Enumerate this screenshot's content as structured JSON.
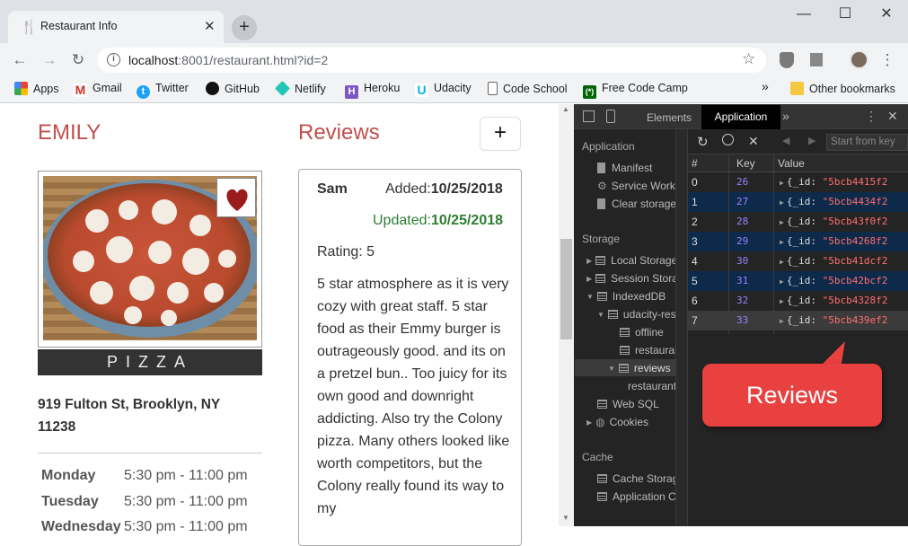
{
  "browser": {
    "tab_title": "Restaurant Info",
    "url_host": "localhost",
    "url_rest": ":8001/restaurant.html?id=2",
    "bookmarks": [
      {
        "label": "Apps",
        "icon": "apps-grid-icon"
      },
      {
        "label": "Gmail",
        "icon": "gmail-icon"
      },
      {
        "label": "Twitter",
        "icon": "twitter-icon"
      },
      {
        "label": "GitHub",
        "icon": "github-icon"
      },
      {
        "label": "Netlify",
        "icon": "netlify-icon"
      },
      {
        "label": "Heroku",
        "icon": "heroku-icon"
      },
      {
        "label": "Udacity",
        "icon": "udacity-icon"
      },
      {
        "label": "Code School",
        "icon": "page-icon"
      },
      {
        "label": "Free Code Camp",
        "icon": "freecodecamp-icon"
      }
    ],
    "other_bookmarks": "Other bookmarks",
    "chevron": "»"
  },
  "restaurant": {
    "name": "EMILY",
    "cuisine": "PIZZA",
    "address": "919 Fulton St, Brooklyn, NY 11238",
    "hours": [
      {
        "day": "Monday",
        "time": "5:30 pm - 11:00 pm"
      },
      {
        "day": "Tuesday",
        "time": "5:30 pm - 11:00 pm"
      },
      {
        "day": "Wednesday",
        "time": "5:30 pm - 11:00 pm"
      }
    ]
  },
  "reviews": {
    "title": "Reviews",
    "add_label": "+",
    "name": "Sam",
    "added_label": "Added:",
    "added_date": "10/25/2018",
    "updated_label": "Updated:",
    "updated_date": "10/25/2018",
    "rating": "Rating: 5",
    "comment": "5 star atmosphere as it is very cozy with great staff. 5 star food as their Emmy burger is outrageously good. and its on a pretzel bun.. Too juicy for its own good and downright addicting. Also try the Colony pizza. Many others looked like worth competitors, but the Colony really found its way to my"
  },
  "devtools": {
    "tabs": {
      "elements": "Elements",
      "application": "Application",
      "more": "»"
    },
    "sections": {
      "application": "Application",
      "storage": "Storage",
      "cache": "Cache"
    },
    "app_items": [
      "Manifest",
      "Service Work",
      "Clear storage"
    ],
    "storage_items": [
      "Local Storage",
      "Session Stora",
      "IndexedDB",
      "udacity-res",
      "offline",
      "restaurai",
      "reviews",
      "restaurant",
      "Web SQL",
      "Cookies"
    ],
    "cache_items": [
      "Cache Storag",
      "Application C"
    ],
    "start_from_key": "Start from key",
    "columns": [
      "#",
      "Key",
      "Value"
    ],
    "rows": [
      {
        "n": "0",
        "key": "26",
        "id": "\"5bcb4415f2"
      },
      {
        "n": "1",
        "key": "27",
        "id": "\"5bcb4434f2"
      },
      {
        "n": "2",
        "key": "28",
        "id": "\"5bcb43f0f2"
      },
      {
        "n": "3",
        "key": "29",
        "id": "\"5bcb4268f2"
      },
      {
        "n": "4",
        "key": "30",
        "id": "\"5bcb41dcf2"
      },
      {
        "n": "5",
        "key": "31",
        "id": "\"5bcb42bcf2"
      },
      {
        "n": "6",
        "key": "32",
        "id": "\"5bcb4328f2"
      },
      {
        "n": "7",
        "key": "33",
        "id": "\"5bcb439ef2"
      }
    ],
    "value_prefix": "{_id: ",
    "callout": "Reviews"
  }
}
